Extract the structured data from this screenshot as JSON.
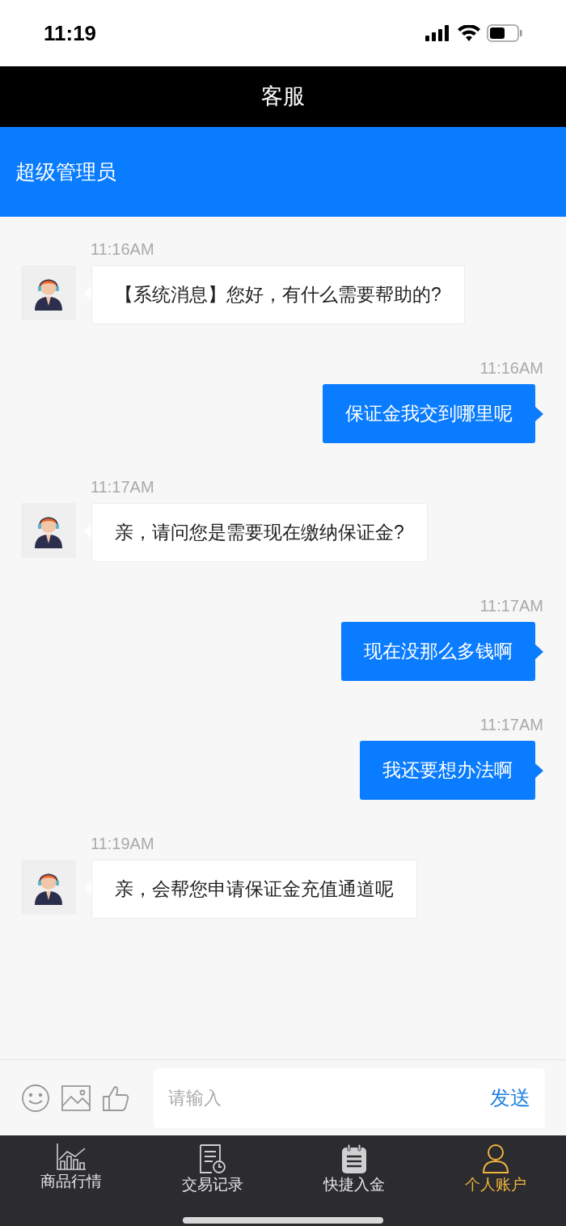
{
  "status_bar": {
    "time": "11:19"
  },
  "header": {
    "title": "客服"
  },
  "chat_header": {
    "title": "超级管理员"
  },
  "messages": [
    {
      "kind": "incoming",
      "time": "11:16AM",
      "text": "【系统消息】您好，有什么需要帮助的?"
    },
    {
      "kind": "outgoing",
      "time": "11:16AM",
      "text": "保证金我交到哪里呢"
    },
    {
      "kind": "incoming",
      "time": "11:17AM",
      "text": "亲，请问您是需要现在缴纳保证金?"
    },
    {
      "kind": "outgoing",
      "time": "11:17AM",
      "text": "现在没那么多钱啊"
    },
    {
      "kind": "outgoing",
      "time": "11:17AM",
      "text": "我还要想办法啊"
    },
    {
      "kind": "incoming",
      "time": "11:19AM",
      "text": "亲，会帮您申请保证金充值通道呢"
    }
  ],
  "composer": {
    "placeholder": "请输入",
    "send": "发送"
  },
  "tabs": [
    {
      "kind": "market",
      "label": "商品行情",
      "selected": false
    },
    {
      "kind": "records",
      "label": "交易记录",
      "selected": false
    },
    {
      "kind": "deposit",
      "label": "快捷入金",
      "selected": false
    },
    {
      "kind": "account",
      "label": "个人账户",
      "selected": true
    }
  ]
}
